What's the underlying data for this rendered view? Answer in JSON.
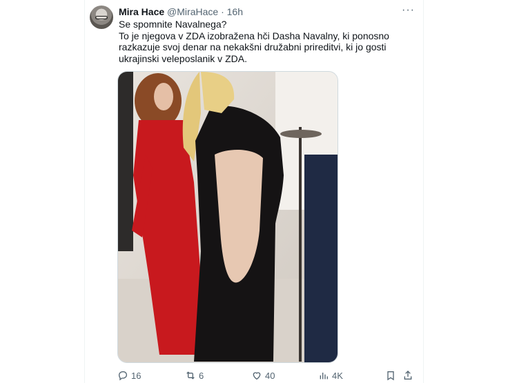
{
  "tweet": {
    "author_name": "Mira Hace",
    "author_handle": "@MiraHace",
    "separator": "·",
    "time": "16h",
    "more_label": "···",
    "text_line1": "Se spomnite Navalnega?",
    "text_line2": "To je njegova v ZDA izobražena hči Dasha Navalny, ki ponosno razkazuje svoj denar na nekakšni družabni prireditvi, ki jo gosti ukrajinski veleposlanik v ZDA."
  },
  "actions": {
    "replies": "16",
    "retweets": "6",
    "likes": "40",
    "views": "4K"
  },
  "icons": [
    "avatar",
    "more-icon",
    "reply-icon",
    "retweet-icon",
    "like-icon",
    "views-icon",
    "bookmark-icon",
    "share-icon"
  ]
}
